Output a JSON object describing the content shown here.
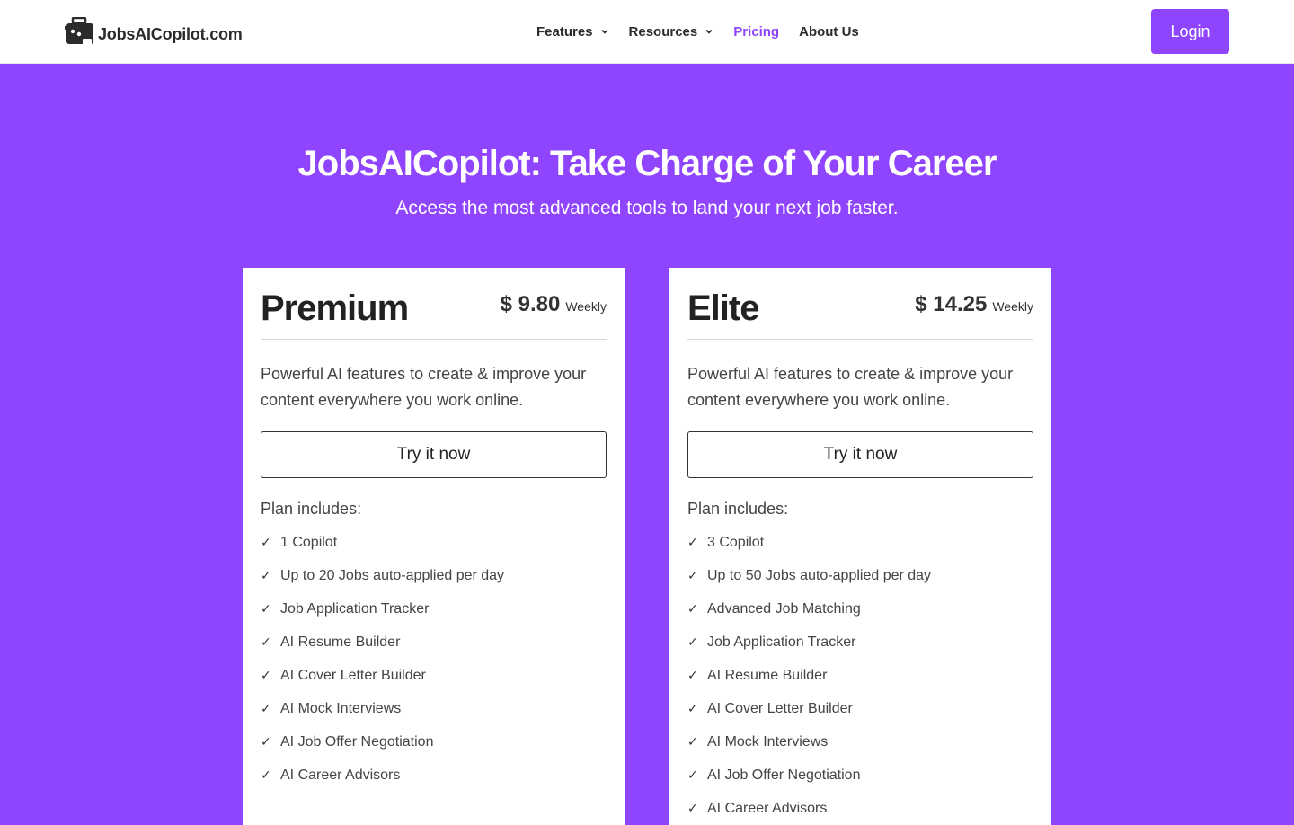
{
  "header": {
    "logo_text": "JobsAICopilot.com",
    "nav": [
      {
        "label": "Features",
        "has_dropdown": true,
        "active": false
      },
      {
        "label": "Resources",
        "has_dropdown": true,
        "active": false
      },
      {
        "label": "Pricing",
        "has_dropdown": false,
        "active": true
      },
      {
        "label": "About Us",
        "has_dropdown": false,
        "active": false
      }
    ],
    "login_label": "Login"
  },
  "hero": {
    "title": "JobsAICopilot: Take Charge of Your Career",
    "subtitle": "Access the most advanced tools to land your next job faster."
  },
  "plans": [
    {
      "name": "Premium",
      "price": "$ 9.80",
      "period": "Weekly",
      "description": "Powerful AI features to create & improve your content everywhere you work online.",
      "cta": "Try it now",
      "includes_label": "Plan includes:",
      "features": [
        "1 Copilot",
        "Up to 20 Jobs auto-applied per day",
        "Job Application Tracker",
        "AI Resume Builder",
        "AI Cover Letter Builder",
        "AI Mock Interviews",
        "AI Job Offer Negotiation",
        "AI Career Advisors"
      ]
    },
    {
      "name": "Elite",
      "price": "$ 14.25",
      "period": "Weekly",
      "description": "Powerful AI features to create & improve your content everywhere you work online.",
      "cta": "Try it now",
      "includes_label": "Plan includes:",
      "features": [
        "3 Copilot",
        "Up to 50 Jobs auto-applied per day",
        "Advanced Job Matching",
        "Job Application Tracker",
        "AI Resume Builder",
        "AI Cover Letter Builder",
        "AI Mock Interviews",
        "AI Job Offer Negotiation",
        "AI Career Advisors"
      ]
    }
  ],
  "colors": {
    "brand": "#8f44fd",
    "text": "#333333"
  },
  "icons": {
    "logo": "briefcase-robot-icon",
    "dropdown": "chevron-down-icon",
    "feature": "check-icon"
  }
}
